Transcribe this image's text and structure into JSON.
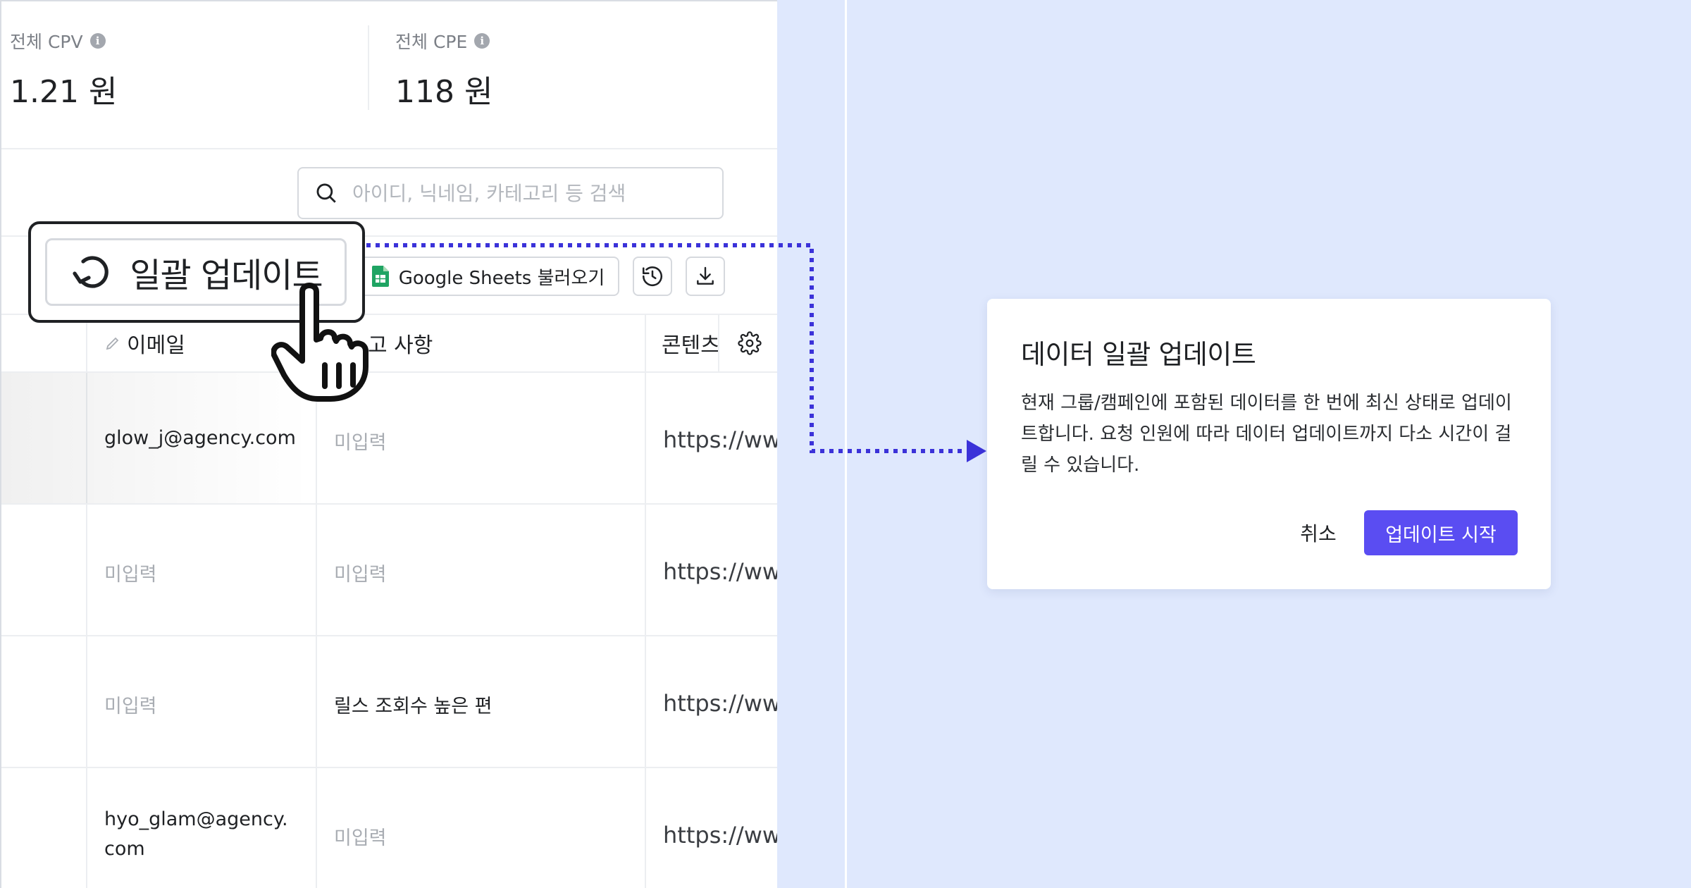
{
  "stats": [
    {
      "label": "전체 CPV",
      "value": "1.21 원"
    },
    {
      "label": "전체 CPE",
      "value": "118 원"
    }
  ],
  "search": {
    "placeholder": "아이디, 닉네임, 카테고리 등 검색"
  },
  "toolbar": {
    "bulk_update_label": "일괄 업데이트",
    "sheets_label": "Google Sheets 불러오기",
    "history_icon": "history-icon",
    "download_icon": "download-icon"
  },
  "table": {
    "columns": [
      "이메일",
      "고 사항",
      "콘텐츠"
    ],
    "rows": [
      {
        "email": "glow_j@agency.com",
        "note": "미입력",
        "content": "https://www"
      },
      {
        "email": "미입력",
        "note": "미입력",
        "content": "https://www"
      },
      {
        "email": "미입력",
        "note": "릴스 조회수 높은 편",
        "content": "https://www"
      },
      {
        "email": "hyo_glam@agency.com",
        "note": "미입력",
        "content": "https://www"
      }
    ]
  },
  "modal": {
    "title": "데이터 일괄 업데이트",
    "description": "현재 그룹/캠페인에 포함된 데이터를 한 번에 최신 상태로 업데이트합니다. 요청 인원에 따라 데이터 업데이트까지 다소 시간이 걸릴 수 있습니다.",
    "cancel_label": "취소",
    "start_label": "업데이트 시작"
  },
  "colors": {
    "accent": "#5a4df2",
    "connector": "#3b32d9",
    "background": "#dfe8fd"
  }
}
